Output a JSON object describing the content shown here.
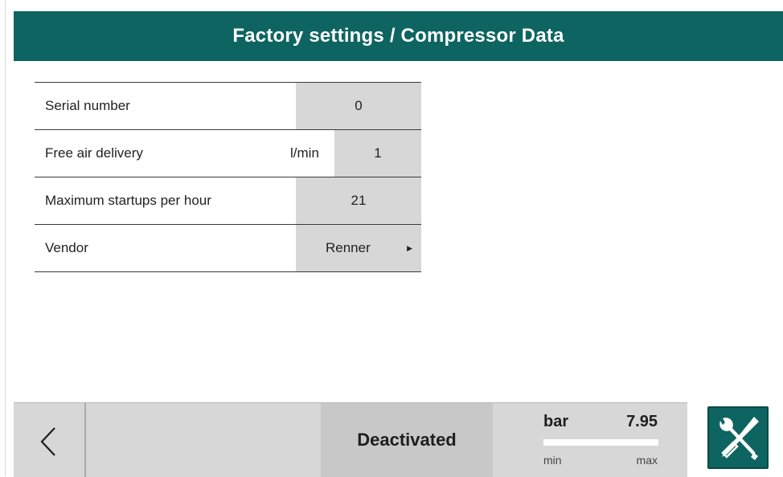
{
  "header": {
    "title": "Factory settings / Compressor Data"
  },
  "settings": {
    "rows": [
      {
        "label": "Serial number",
        "unit": "",
        "value": "0"
      },
      {
        "label": "Free air delivery",
        "unit": "l/min",
        "value": "1"
      },
      {
        "label": "Maximum startups per hour",
        "unit": "",
        "value": "21"
      },
      {
        "label": "Vendor",
        "unit": "",
        "value": "Renner"
      }
    ]
  },
  "footer": {
    "back_icon": "chevron-left-icon",
    "status": "Deactivated",
    "pressure": {
      "unit": "bar",
      "value": "7.95",
      "min_label": "min",
      "max_label": "max"
    },
    "tools_icon": "wrench-screwdriver-icon"
  },
  "colors": {
    "header_bg": "#0e6460",
    "panel_gray": "#d7d7d7",
    "status_gray": "#c8c8c8",
    "tools_bg": "#0e6460"
  }
}
